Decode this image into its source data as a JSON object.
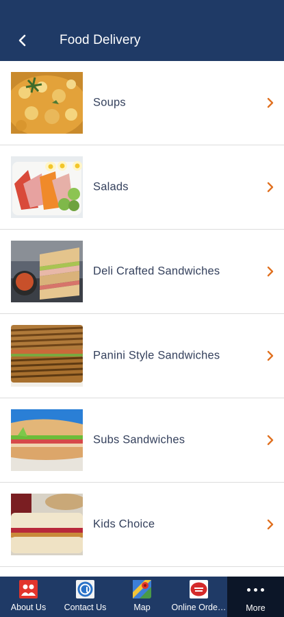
{
  "header": {
    "title": "Food Delivery",
    "background": "#1f3a66"
  },
  "categories": [
    {
      "label": "Soups",
      "icon": "soup-photo"
    },
    {
      "label": "Salads",
      "icon": "salad-photo"
    },
    {
      "label": "Deli Crafted Sandwiches",
      "icon": "deli-sandwich-photo"
    },
    {
      "label": "Panini Style Sandwiches",
      "icon": "panini-photo"
    },
    {
      "label": "Subs Sandwiches",
      "icon": "sub-sandwich-photo"
    },
    {
      "label": "Kids Choice",
      "icon": "kids-sandwich-photo"
    }
  ],
  "chevron_color": "#e07020",
  "tabbar": {
    "tabs": [
      {
        "label": "About Us",
        "icon": "people-icon"
      },
      {
        "label": "Contact Us",
        "icon": "contact-icon"
      },
      {
        "label": "Map",
        "icon": "map-icon"
      },
      {
        "label": "Online Order...",
        "icon": "online-order-icon"
      },
      {
        "label": "More",
        "icon": "more-dots-icon",
        "active": true
      }
    ]
  }
}
